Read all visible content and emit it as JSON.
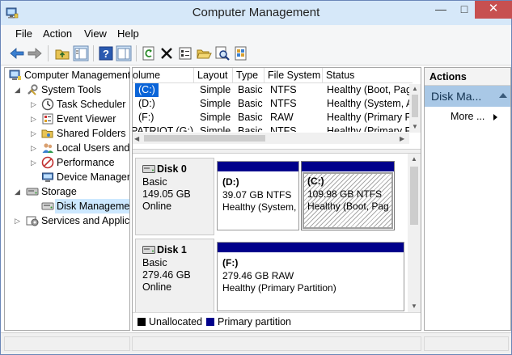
{
  "window": {
    "title": "Computer Management",
    "min_glyph": "—",
    "max_glyph": "□",
    "close_glyph": "✕"
  },
  "menu": [
    "File",
    "Action",
    "View",
    "Help"
  ],
  "tree": {
    "root": "Computer Management",
    "system_tools": "System Tools",
    "task_scheduler": "Task Scheduler",
    "event_viewer": "Event Viewer",
    "shared_folders": "Shared Folders",
    "local_users": "Local Users and",
    "performance": "Performance",
    "device_manager": "Device Manager",
    "storage": "Storage",
    "disk_management": "Disk Manageme",
    "services": "Services and Applic"
  },
  "volume_list": {
    "columns": [
      "olume",
      "Layout",
      "Type",
      "File System",
      "Status"
    ],
    "rows": [
      [
        "(C:)",
        "Simple",
        "Basic",
        "NTFS",
        "Healthy (Boot, Pag"
      ],
      [
        "(D:)",
        "Simple",
        "Basic",
        "NTFS",
        "Healthy (System, A"
      ],
      [
        "(F:)",
        "Simple",
        "Basic",
        "RAW",
        "Healthy (Primary P"
      ],
      [
        "PATRIOT (G:)",
        "Simple",
        "Basic",
        "NTFS",
        "Healthy (Primary P"
      ]
    ]
  },
  "disks": [
    {
      "name": "Disk 0",
      "type": "Basic",
      "size": "149.05 GB",
      "state": "Online",
      "partitions": [
        {
          "label": "(D:)",
          "size": "39.07 GB NTFS",
          "status": "Healthy (System,"
        },
        {
          "label": "(C:)",
          "size": "109.98 GB NTFS",
          "status": "Healthy (Boot, Pag"
        }
      ]
    },
    {
      "name": "Disk 1",
      "type": "Basic",
      "size": "279.46 GB",
      "state": "Online",
      "partitions": [
        {
          "label": "(F:)",
          "size": "279.46 GB RAW",
          "status": "Healthy (Primary Partition)"
        }
      ]
    }
  ],
  "legend": {
    "unallocated": "Unallocated",
    "primary": "Primary partition",
    "unallocated_color": "#000000",
    "primary_color": "#00008b"
  },
  "actions": {
    "header": "Actions",
    "section": "Disk Ma...",
    "more": "More ..."
  }
}
